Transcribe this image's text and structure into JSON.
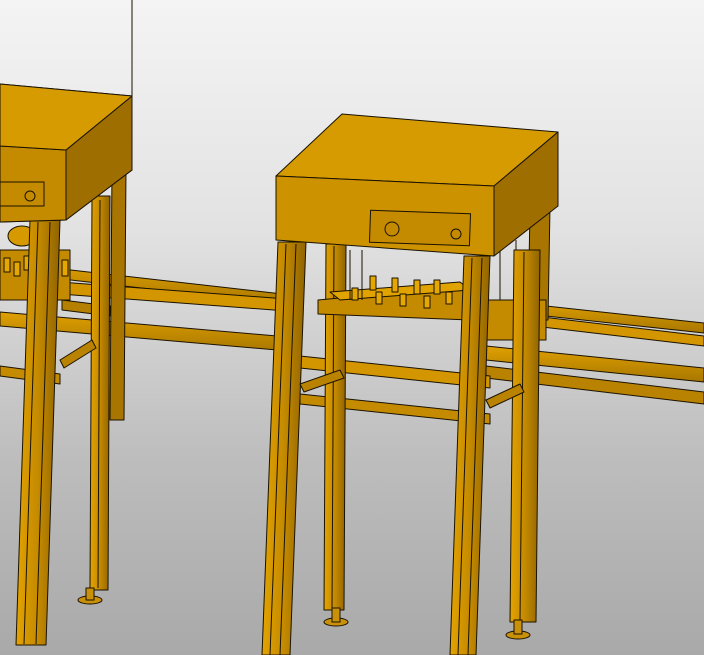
{
  "scene": {
    "subject": "cad-render-machine-frame",
    "colors": {
      "background_top": "#f4f4f4",
      "background_bottom": "#a9a9a9",
      "body_light": "#d99a00",
      "body_mid": "#c48a00",
      "body_dark": "#9a6b00",
      "outline": "#1a1200",
      "foot": "#c9900a"
    },
    "stations": [
      {
        "name": "left-station"
      },
      {
        "name": "center-station"
      }
    ]
  }
}
